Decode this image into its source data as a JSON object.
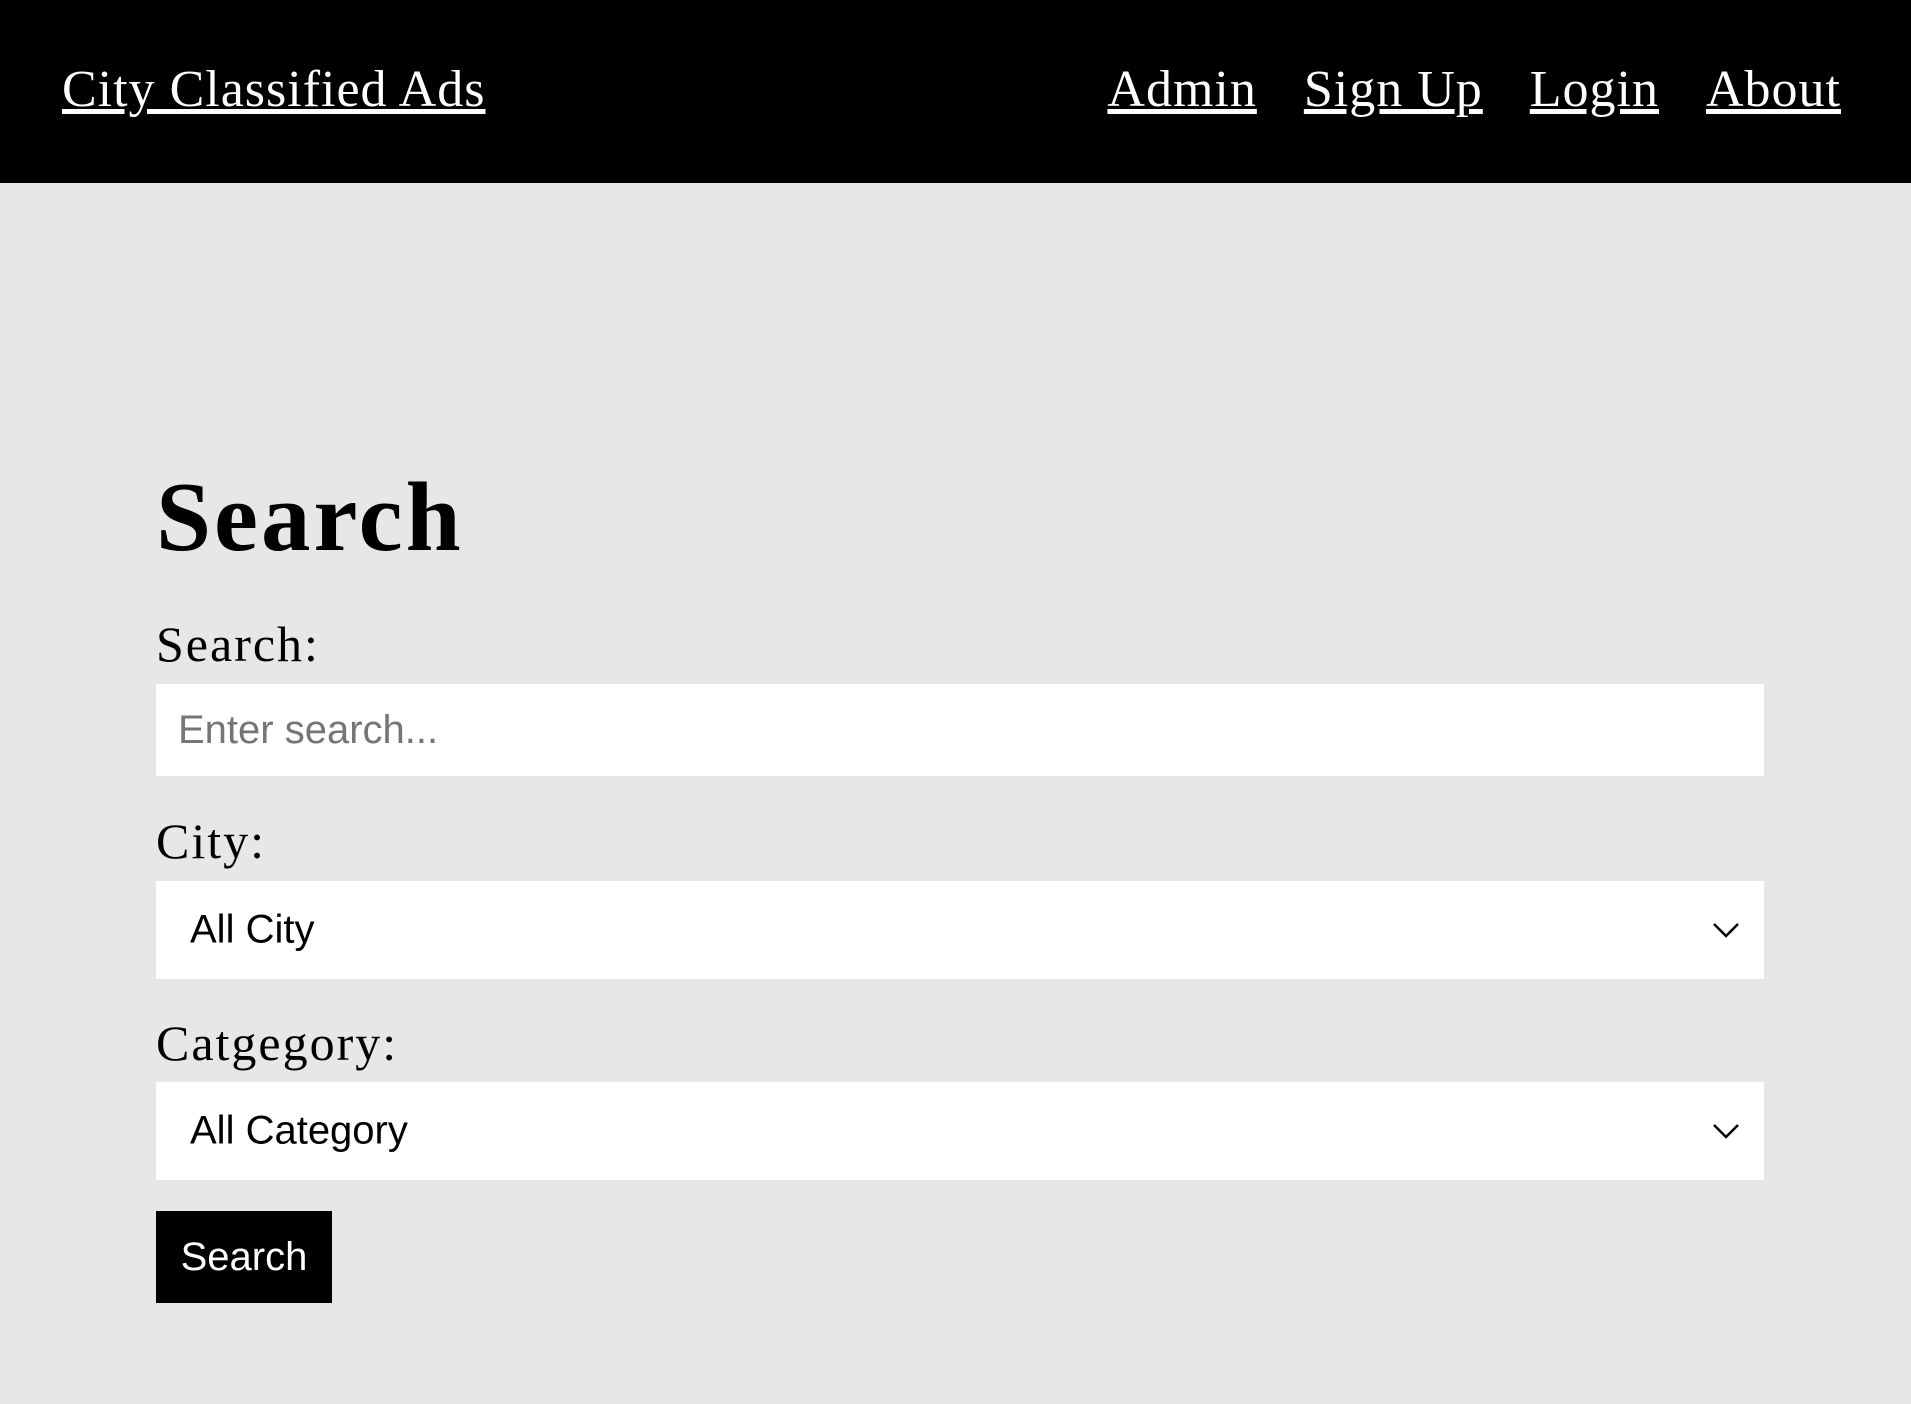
{
  "header": {
    "brand": "City Classified Ads",
    "nav": [
      {
        "label": "Admin"
      },
      {
        "label": "Sign Up"
      },
      {
        "label": "Login"
      },
      {
        "label": "About"
      }
    ]
  },
  "main": {
    "title": "Search",
    "search_label": "Search:",
    "search_placeholder": "Enter search...",
    "search_value": "",
    "city_label": "City:",
    "city_selected": "All City",
    "category_label": "Catgegory:",
    "category_selected": "All Category",
    "submit_label": "Search"
  },
  "colors": {
    "header_bg": "#000000",
    "page_bg": "#e6e7e9",
    "button_bg": "#000000",
    "field_bg": "#ffffff"
  },
  "icons": {
    "city_dropdown": "chevron-down-icon",
    "category_dropdown": "chevron-down-icon"
  }
}
